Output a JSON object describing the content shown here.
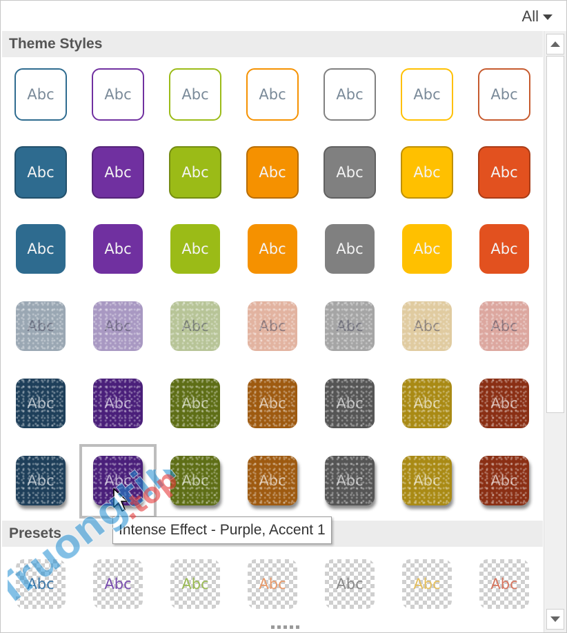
{
  "filter": {
    "label": "All",
    "icon": "chevron-down-icon"
  },
  "sections": {
    "theme_styles": "Theme Styles",
    "presets": "Presets"
  },
  "tile_text": "Abc",
  "colors": {
    "blue": "#2e6b8f",
    "purple": "#7030a0",
    "green": "#9bbb17",
    "orange": "#f59100",
    "gray": "#808080",
    "gold": "#ffc000",
    "red": "#e2511f"
  },
  "rows": [
    {
      "style": "outline",
      "colors": [
        "#2e6b8f",
        "#7030a0",
        "#9bbb17",
        "#f59100",
        "#808080",
        "#ffc000",
        "#c65a2e"
      ]
    },
    {
      "style": "filled",
      "colors": [
        "#2e6b8f",
        "#7030a0",
        "#9bbb17",
        "#f59100",
        "#808080",
        "#ffc000",
        "#e2511f"
      ]
    },
    {
      "style": "flat",
      "colors": [
        "#2e6b8f",
        "#7030a0",
        "#9bbb17",
        "#f59100",
        "#808080",
        "#ffc000",
        "#e2511f"
      ]
    },
    {
      "style": "texture",
      "colors": [
        "#9aa7b3",
        "#a898c2",
        "#b7c497",
        "#e2b3a0",
        "#a5a5a5",
        "#e0cba0",
        "#dca79f"
      ]
    },
    {
      "style": "texture-dark",
      "colors": [
        "#1e3f5a",
        "#4a1f7a",
        "#5e6e16",
        "#9e5a10",
        "#555555",
        "#a98a14",
        "#8a2f14"
      ]
    },
    {
      "style": "texture-dark shadowed",
      "colors": [
        "#1e3f5a",
        "#4a1f7a",
        "#5e6e16",
        "#9e5a10",
        "#555555",
        "#a98a14",
        "#8a2f14"
      ]
    }
  ],
  "preset_text_colors": [
    "#3b77a8",
    "#7b4fb0",
    "#9bbb55",
    "#e89a6a",
    "#8a8a8a",
    "#e5c060",
    "#d77760"
  ],
  "tooltip": "Intense Effect - Purple, Accent 1",
  "watermark": "Truongtin.top"
}
